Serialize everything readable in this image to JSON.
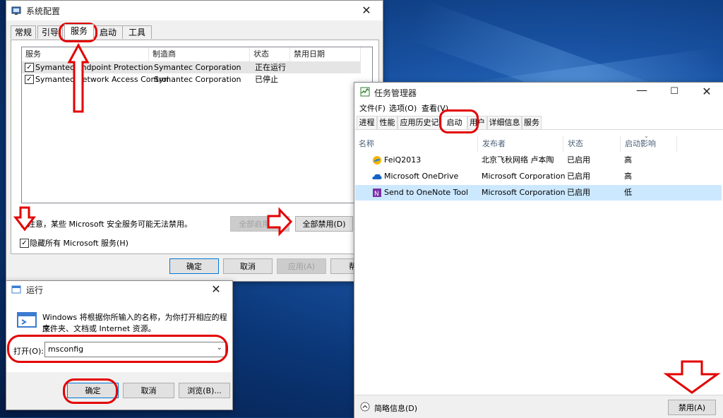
{
  "syscfg": {
    "title": "系统配置",
    "tabs": [
      "常规",
      "引导",
      "服务",
      "启动",
      "工具"
    ],
    "columns": [
      "服务",
      "制造商",
      "状态",
      "禁用日期"
    ],
    "rows": [
      {
        "service": "Symantec Endpoint Protection",
        "vendor": "Symantec Corporation",
        "status": "正在运行",
        "checked": true
      },
      {
        "service": "Symantec Network Access Control",
        "vendor": "Symantec Corporation",
        "status": "已停止",
        "checked": true
      }
    ],
    "note": "请注意，某些 Microsoft 安全服务可能无法禁用。",
    "enable_all": "全部启用(E)",
    "disable_all": "全部禁用(D)",
    "hide_ms_label": "隐藏所有 Microsoft 服务(H)",
    "ok": "确定",
    "cancel": "取消",
    "apply": "应用(A)",
    "help": "帮"
  },
  "run": {
    "title": "运行",
    "desc1": "Windows 将根据你所输入的名称，为你打开相应的程序、",
    "desc2": "文件夹、文档或 Internet 资源。",
    "open_label": "打开(O):",
    "open_value": "msconfig",
    "ok": "确定",
    "cancel": "取消",
    "browse": "浏览(B)..."
  },
  "taskmgr": {
    "title": "任务管理器",
    "menu": [
      "文件(F)",
      "选项(O)",
      "查看(V)"
    ],
    "tabs": [
      "进程",
      "性能",
      "应用历史记录",
      "启动",
      "用户",
      "详细信息",
      "服务"
    ],
    "columns": [
      "名称",
      "发布者",
      "状态",
      "启动影响"
    ],
    "rows": [
      {
        "name": "FeiQ2013",
        "publisher": "北京飞秋网络 卢本陶",
        "status": "已启用",
        "impact": "高",
        "icon": "feiq-icon"
      },
      {
        "name": "Microsoft OneDrive",
        "publisher": "Microsoft Corporation",
        "status": "已启用",
        "impact": "高",
        "icon": "onedrive-icon"
      },
      {
        "name": "Send to OneNote Tool",
        "publisher": "Microsoft Corporation",
        "status": "已启用",
        "impact": "低",
        "icon": "onenote-icon"
      }
    ],
    "fewer_details": "简略信息(D)",
    "disable": "禁用(A)"
  },
  "colors": {
    "annotation": "#e30000",
    "selection": "#cce8ff",
    "accent": "#0078d7"
  }
}
